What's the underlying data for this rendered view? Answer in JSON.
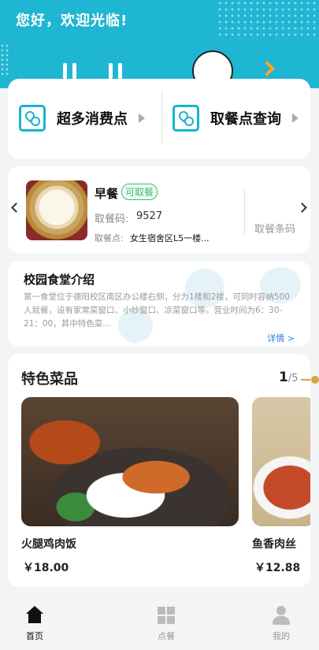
{
  "header": {
    "greeting": "您好，欢迎光临!"
  },
  "entries": [
    {
      "label": "超多消费点",
      "icon": "map-location-icon"
    },
    {
      "label": "取餐点查询",
      "icon": "map-location-icon"
    }
  ],
  "order": {
    "meal": "早餐",
    "status": "可取餐",
    "code_label": "取餐码:",
    "code": "9527",
    "pickup_label": "取餐点:",
    "pickup": "女生宿舍区L5一楼...",
    "barcode_button": "取餐条码"
  },
  "intro": {
    "title": "校园食堂介绍",
    "text": "第一食堂位于德阳校区南区办公楼右侧，分为1楼和2楼，可同时容纳500人就餐，设有家常菜窗口、小炒窗口、凉菜窗口等。营业时间为6：30-21：00，其中特色菜...",
    "more": "详情 >"
  },
  "featured": {
    "title": "特色菜品",
    "pager_current": "1",
    "pager_total": "/5",
    "dishes": [
      {
        "name": "火腿鸡肉饭",
        "price": "￥18.00"
      },
      {
        "name": "鱼香肉丝",
        "price": "￥12.88"
      }
    ]
  },
  "tabbar": {
    "items": [
      {
        "label": "首页",
        "active": true,
        "icon": "home-icon"
      },
      {
        "label": "点餐",
        "active": false,
        "icon": "grid-icon"
      },
      {
        "label": "我的",
        "active": false,
        "icon": "user-icon"
      }
    ]
  },
  "colors": {
    "header": "#1fb6d3",
    "accent": "#19b3cf",
    "status_green": "#38c16b",
    "link_blue": "#2b7bd8",
    "pager_gold": "#d6a740"
  }
}
